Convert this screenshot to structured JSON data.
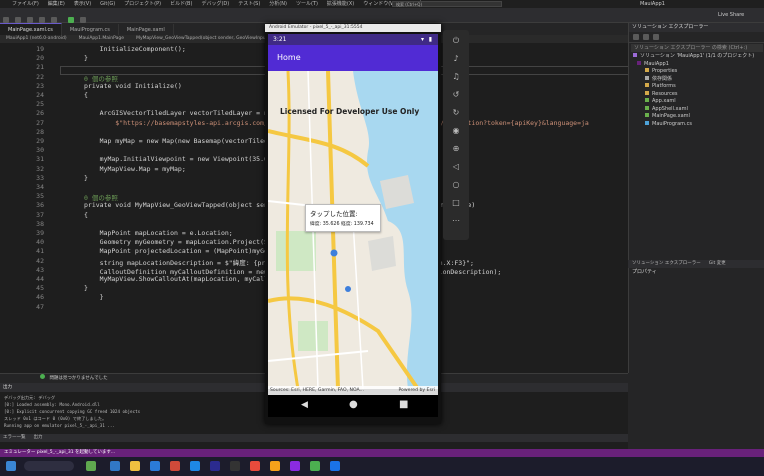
{
  "vs": {
    "menu": [
      "ファイル(F)",
      "編集(E)",
      "表示(V)",
      "Git(G)",
      "プロジェクト(P)",
      "ビルド(B)",
      "デバッグ(D)",
      "テスト(S)",
      "分析(N)",
      "ツール(T)",
      "拡張機能(X)",
      "ウィンドウ(W)",
      "ヘルプ(H)"
    ],
    "search_placeholder": "検索 (Ctrl+Q)",
    "window_title": "MauiApp1",
    "live_share": "Live Share",
    "tabs": [
      "MainPage.xaml.cs",
      "MauiProgram.cs",
      "MainPage.xaml"
    ],
    "editor_nav": [
      "MauiApp1 (net6.0-android)",
      "MauiApp1.MainPage",
      "MyMapView_GeoViewTapped(object sender, GeoViewInputEventArgs e)"
    ],
    "code_lines": [
      {
        "n": "19",
        "t": "            InitializeComponent();"
      },
      {
        "n": "20",
        "t": "        }"
      },
      {
        "n": "21",
        "t": ""
      },
      {
        "n": "22",
        "t": "        0 個の参照"
      },
      {
        "n": "23",
        "t": "        private void Initialize()"
      },
      {
        "n": "24",
        "t": "        {"
      },
      {
        "n": "25",
        "t": ""
      },
      {
        "n": "26",
        "t": "            ArcGISVectorTiledLayer vectorTiledLayer = new ArcGISVectorTiledLayer(new Uri("
      },
      {
        "n": "27",
        "t": "                $\"https://basemapstyles-api.arcgis.com/arcgis/rest/services/styles/v2/styles/arcgis/navigation?token={apiKey}&language=ja"
      },
      {
        "n": "28",
        "t": ""
      },
      {
        "n": "29",
        "t": "            Map myMap = new Map(new Basemap(vectorTiledLayer));"
      },
      {
        "n": "30",
        "t": ""
      },
      {
        "n": "31",
        "t": "            myMap.InitialViewpoint = new Viewpoint(35.6, 139.7, 100000);"
      },
      {
        "n": "32",
        "t": "            MyMapView.Map = myMap;"
      },
      {
        "n": "33",
        "t": "        }"
      },
      {
        "n": "34",
        "t": ""
      },
      {
        "n": "35",
        "t": "        0 個の参照"
      },
      {
        "n": "36",
        "t": "        private void MyMapView_GeoViewTapped(object sender, Esri.ArcGISRuntime.Maui.GeoViewInputEventArgs e)"
      },
      {
        "n": "37",
        "t": "        {"
      },
      {
        "n": "38",
        "t": ""
      },
      {
        "n": "39",
        "t": "            MapPoint mapLocation = e.Location;"
      },
      {
        "n": "40",
        "t": "            Geometry myGeometry = mapLocation.Project(SpatialReferences.Wgs84);"
      },
      {
        "n": "41",
        "t": "            MapPoint projectedLocation = (MapPoint)myGeometry;"
      },
      {
        "n": "42",
        "t": "            string mapLocationDescription = $\"緯度: {projectedLocation.Y:F3} 経度: {projectedLocation.X:F3}\";"
      },
      {
        "n": "43",
        "t": "            CalloutDefinition myCalloutDefinition = new CalloutDefinition(\"タップした位置:\", mapLocationDescription);"
      },
      {
        "n": "44",
        "t": "            MyMapView.ShowCalloutAt(mapLocation, myCalloutDefinition);"
      },
      {
        "n": "45",
        "t": "        }"
      },
      {
        "n": "46",
        "t": "    }"
      },
      {
        "n": "47",
        "t": ""
      }
    ],
    "solution_explorer": {
      "title": "ソリューション エクスプローラー",
      "search_placeholder": "ソリューション エクスプローラー の検索 (Ctrl+:)",
      "items": [
        "ソリューション 'MauiApp1' (1/1 のプロジェクト)",
        "MauiApp1",
        "Properties",
        "依存関係",
        "Platforms",
        "Resources",
        "App.xaml",
        "AppShell.xaml",
        "MainPage.xaml",
        "MauiProgram.cs"
      ],
      "bottom_tabs": [
        "ソリューション エクスプローラー",
        "Git 変更"
      ]
    },
    "properties_title": "プロパティ",
    "output": {
      "title": "出力",
      "status_text": "問題は見つかりませんでした",
      "lines": [
        "デバッグ出力元: デバッグ",
        "[0:] Loaded assembly: Mono.Android.dll",
        "[0:] Explicit concurrent copying GC freed 1024 objects",
        "スレッド 0x1 はコード 0 (0x0) で終了しました。",
        "Running app on emulator pixel_5_-_api_31 ..."
      ],
      "tabs": [
        "エラー一覧",
        "出力"
      ]
    },
    "statusbar": "エミュレーター pixel_5_-_api_31 を起動しています..."
  },
  "emulator": {
    "title": "Android Emulator - pixel_5_-_api_31:5554",
    "clock": "3:21",
    "app_title": "Home",
    "watermark": "Licensed For Developer Use Only",
    "callout_title": "タップした位置:",
    "callout_text": "緯度: 35.626 経度: 139.734",
    "attribution_left": "Sources: Esri, HERE, Garmin, FAO, NOA...",
    "attribution_right": "Powered by Esri"
  },
  "colors": {
    "vs_accent": "#68217a",
    "app_bar": "#512bd4",
    "water": "#a8d8f0",
    "road": "#f5c842"
  }
}
